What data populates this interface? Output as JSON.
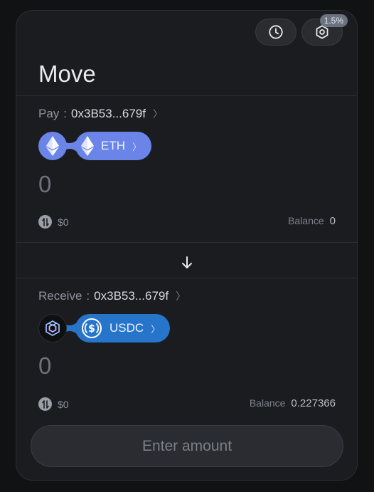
{
  "header": {
    "title": "Move",
    "history_icon": "clock-icon",
    "settings_icon": "hexagon-gear-icon",
    "slippage": "1.5%"
  },
  "pay": {
    "label": "Pay",
    "separator": ":",
    "address": "0x3B53...679f",
    "chain_icon": "ethereum-icon",
    "token": "ETH",
    "token_icon": "ethereum-icon",
    "amount": "0",
    "usd_value": "$0",
    "balance_label": "Balance",
    "balance_value": "0"
  },
  "receive": {
    "label": "Receive",
    "separator": ":",
    "address": "0x3B53...679f",
    "chain_icon": "cube-chain-icon",
    "token": "USDC",
    "token_icon": "usdc-icon",
    "amount": "0",
    "usd_value": "$0",
    "balance_label": "Balance",
    "balance_value": "0.227366"
  },
  "switch_icon": "arrow-down-icon",
  "cta": {
    "label": "Enter amount"
  },
  "colors": {
    "background": "#111214",
    "card": "#1b1c1f",
    "eth_pill": "#6a84e8",
    "usdc_pill": "#2775ca"
  }
}
